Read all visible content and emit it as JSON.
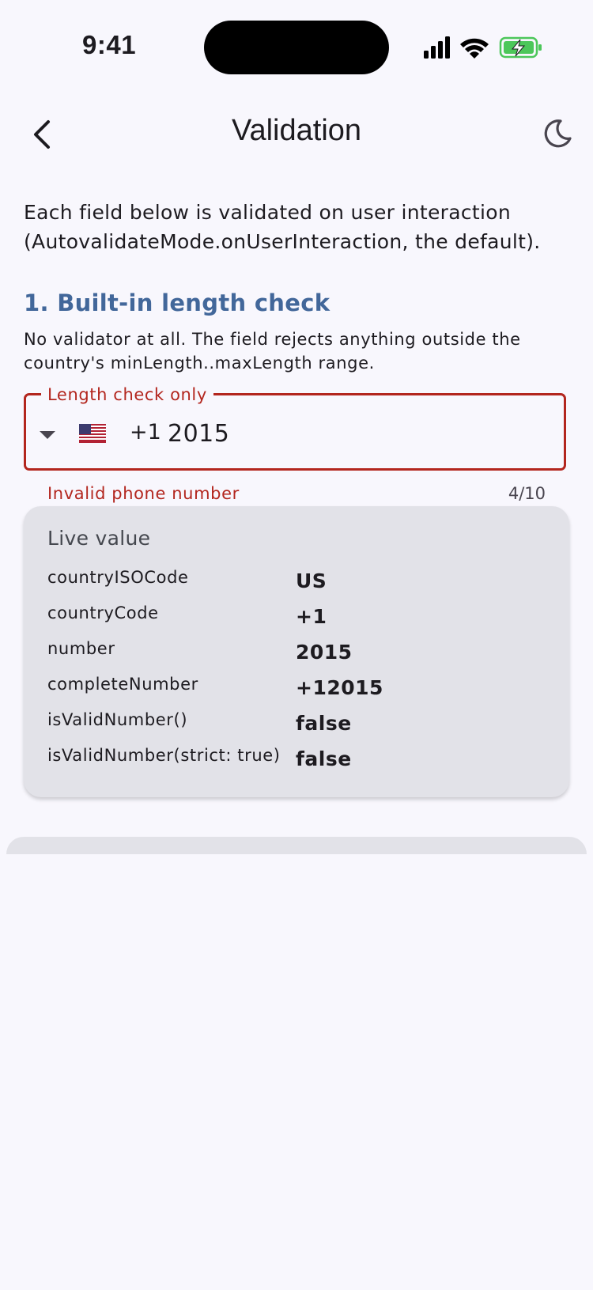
{
  "status_bar": {
    "time": "9:41"
  },
  "app_bar": {
    "title": "Validation",
    "back_icon": "chevron-left-icon",
    "theme_icon": "moon-icon"
  },
  "intro": "Each field below is validated on user interaction (AutovalidateMode.onUserInteraction, the default).",
  "section": {
    "title": "1. Built-in length check",
    "description": "No validator at all. The field rejects anything outside the country's minLength..maxLength range."
  },
  "phone_field": {
    "label": "Length check only",
    "country_flag": "us-flag",
    "dial_code": "+1",
    "value": "2015",
    "error": "Invalid phone number",
    "counter": "4/10",
    "error_color": "#b3261e"
  },
  "live_value": {
    "title": "Live value",
    "rows": [
      {
        "key": "countryISOCode",
        "value": "US"
      },
      {
        "key": "countryCode",
        "value": "+1"
      },
      {
        "key": "number",
        "value": "2015"
      },
      {
        "key": "completeNumber",
        "value": "+12015"
      },
      {
        "key": "isValidNumber()",
        "value": "false"
      },
      {
        "key": "isValidNumber(strict: true)",
        "value": "false"
      }
    ]
  },
  "colors": {
    "accent": "#42679a",
    "background": "#f8f7fd",
    "card": "#e2e2e8"
  }
}
